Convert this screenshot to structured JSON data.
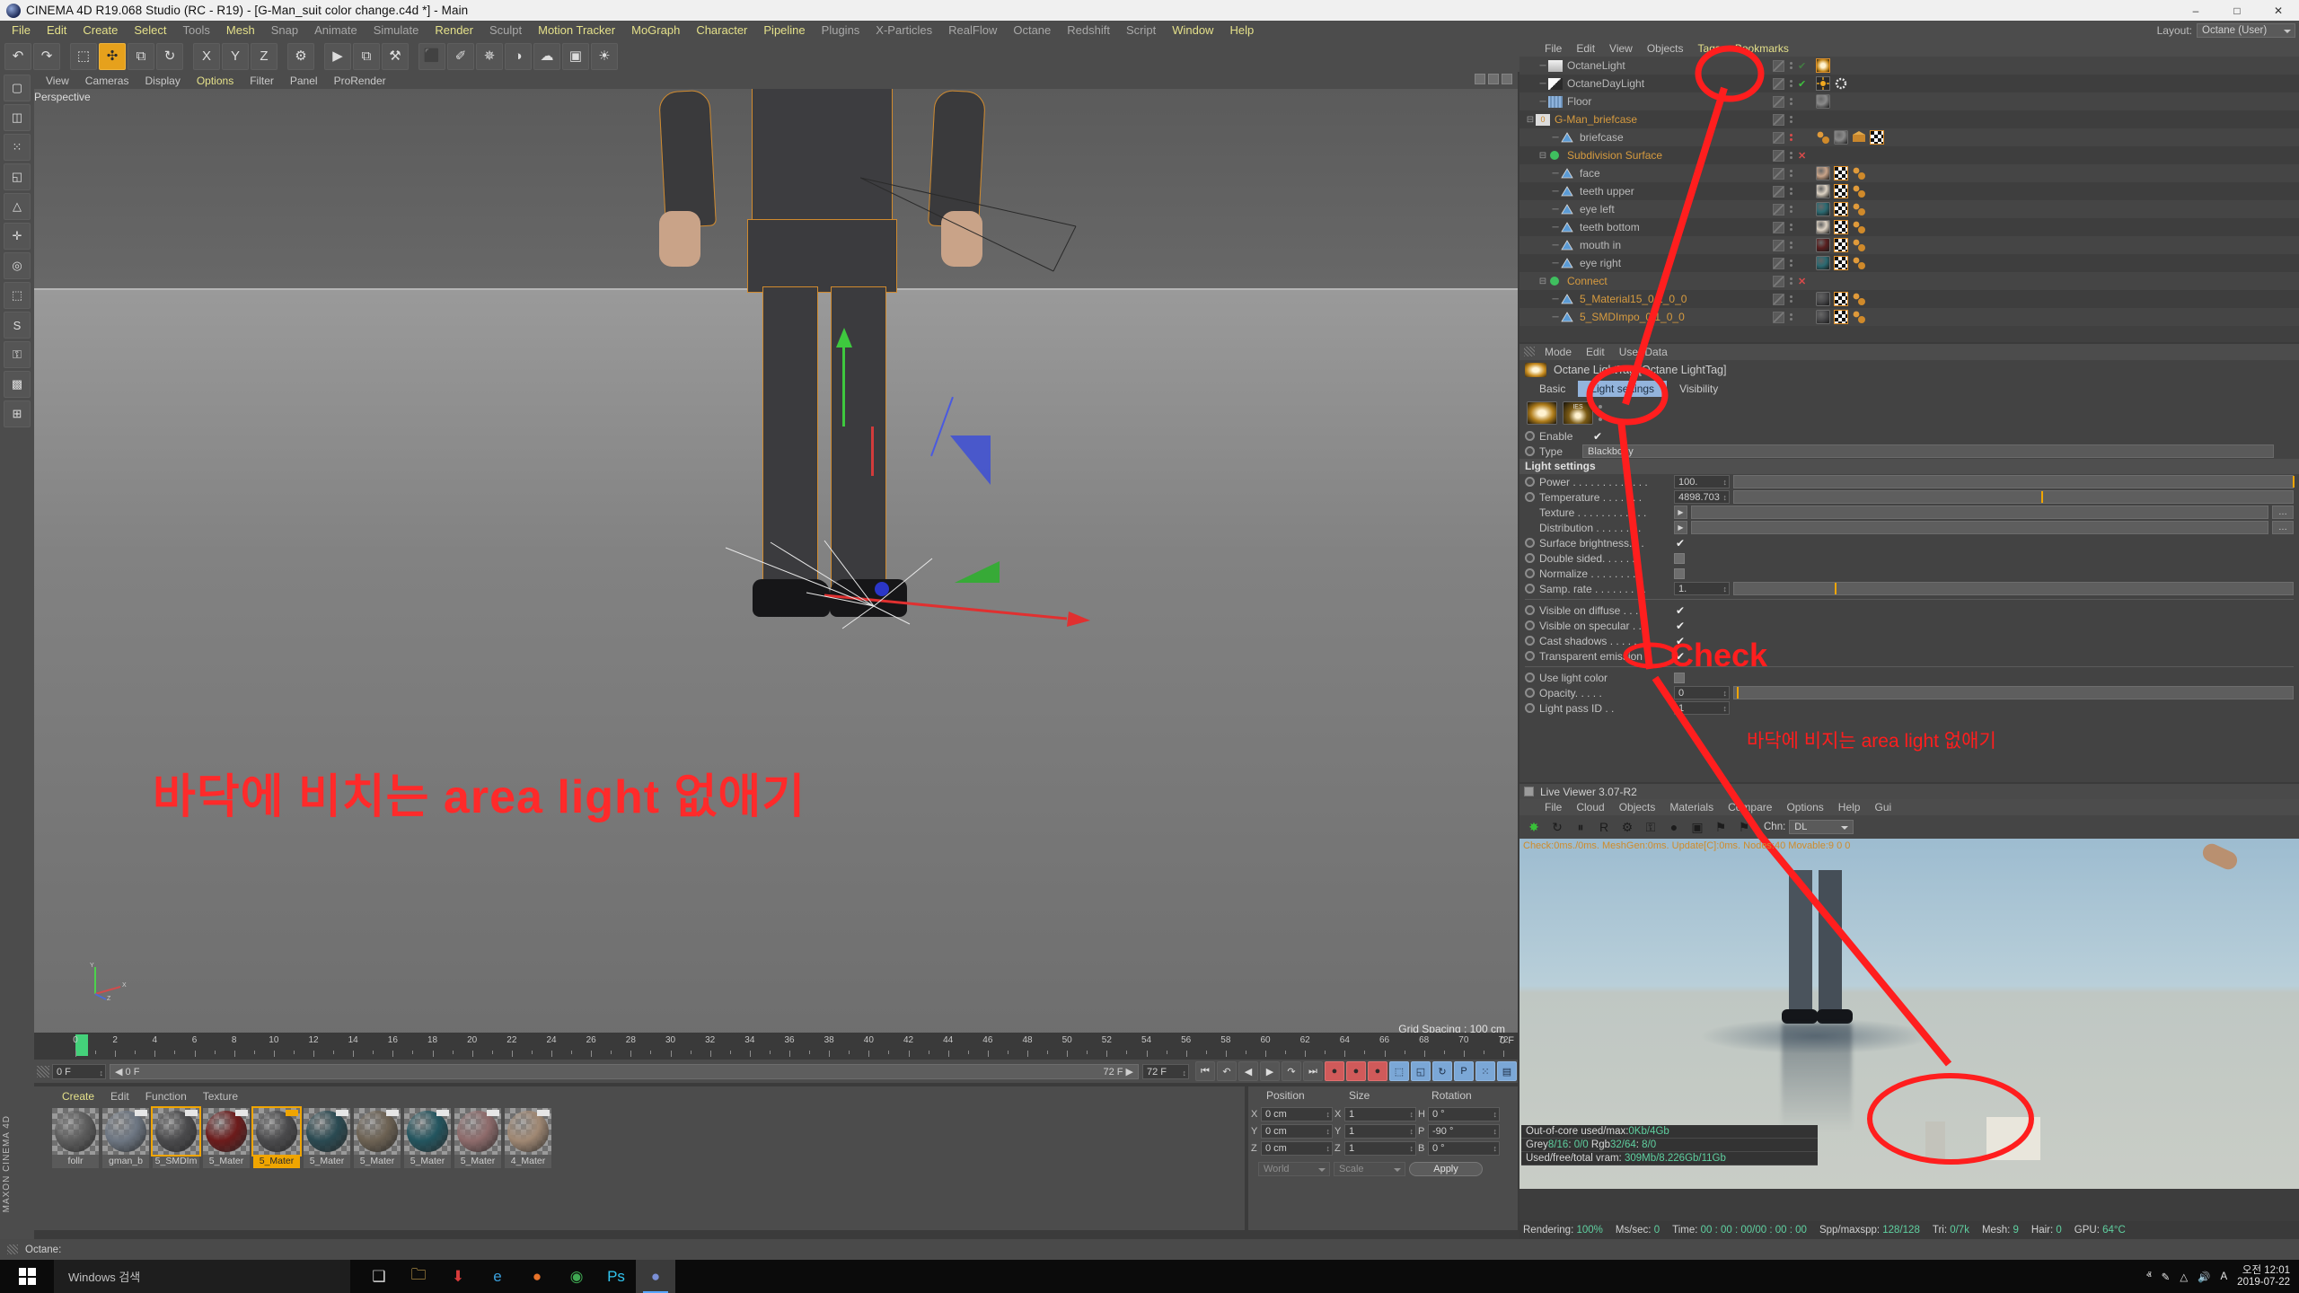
{
  "window": {
    "title": "CINEMA 4D R19.068 Studio (RC - R19) - [G-Man_suit color change.c4d *] - Main",
    "minimize": "–",
    "maximize": "□",
    "close": "✕"
  },
  "menubar": {
    "items": [
      {
        "label": "File",
        "hi": true
      },
      {
        "label": "Edit",
        "hi": true
      },
      {
        "label": "Create",
        "hi": true
      },
      {
        "label": "Select",
        "hi": true
      },
      {
        "label": "Tools",
        "hi": false
      },
      {
        "label": "Mesh",
        "hi": true
      },
      {
        "label": "Snap",
        "hi": false
      },
      {
        "label": "Animate",
        "hi": false
      },
      {
        "label": "Simulate",
        "hi": false
      },
      {
        "label": "Render",
        "hi": true
      },
      {
        "label": "Sculpt",
        "hi": false
      },
      {
        "label": "Motion Tracker",
        "hi": true
      },
      {
        "label": "MoGraph",
        "hi": true
      },
      {
        "label": "Character",
        "hi": true
      },
      {
        "label": "Pipeline",
        "hi": true
      },
      {
        "label": "Plugins",
        "hi": false
      },
      {
        "label": "X-Particles",
        "hi": false
      },
      {
        "label": "RealFlow",
        "hi": false
      },
      {
        "label": "Octane",
        "hi": false
      },
      {
        "label": "Redshift",
        "hi": false
      },
      {
        "label": "Script",
        "hi": false
      },
      {
        "label": "Window",
        "hi": true
      },
      {
        "label": "Help",
        "hi": true
      }
    ],
    "layout_label": "Layout:",
    "layout_value": "Octane (User)"
  },
  "toolbar": {
    "buttons": [
      {
        "name": "undo",
        "glyph": "↶",
        "sel": false
      },
      {
        "name": "redo",
        "glyph": "↷",
        "sel": false
      },
      {
        "name": "live-selection",
        "glyph": "⬚",
        "sel": false
      },
      {
        "name": "move",
        "glyph": "✣",
        "sel": true
      },
      {
        "name": "scale",
        "glyph": "⧉",
        "sel": false
      },
      {
        "name": "rotate",
        "glyph": "↻",
        "sel": false
      },
      {
        "name": "lock-x",
        "glyph": "X",
        "sel": false
      },
      {
        "name": "lock-y",
        "glyph": "Y",
        "sel": false
      },
      {
        "name": "lock-z",
        "glyph": "Z",
        "sel": false
      },
      {
        "name": "world-object",
        "glyph": "⚙",
        "sel": false
      },
      {
        "name": "render-view",
        "glyph": "▶",
        "sel": false
      },
      {
        "name": "render-region",
        "glyph": "⧉",
        "sel": false
      },
      {
        "name": "render-settings",
        "glyph": "⚒",
        "sel": false
      },
      {
        "name": "cube-primitive",
        "glyph": "⬛",
        "sel": false
      },
      {
        "name": "spline-pen",
        "glyph": "✐",
        "sel": false
      },
      {
        "name": "generator",
        "glyph": "✵",
        "sel": false
      },
      {
        "name": "bend-deformer",
        "glyph": "◑",
        "sel": false
      },
      {
        "name": "environment",
        "glyph": "☁",
        "sel": false
      },
      {
        "name": "camera",
        "glyph": "▣",
        "sel": false
      },
      {
        "name": "light",
        "glyph": "☀",
        "sel": false
      }
    ],
    "right_buttons": [
      {
        "name": "octane-live-viewer",
        "glyph": "✸"
      },
      {
        "name": "octane-settings",
        "glyph": "▦"
      },
      {
        "name": "octane-texture",
        "glyph": "T"
      },
      {
        "name": "octane-object",
        "glyph": "□"
      },
      {
        "name": "nav-prev",
        "glyph": "‹"
      },
      {
        "name": "nav-next",
        "glyph": "›"
      },
      {
        "name": "layout-panels",
        "glyph": "▤"
      }
    ]
  },
  "left_toolbar": {
    "buttons": [
      {
        "name": "model-mode",
        "glyph": "▢"
      },
      {
        "name": "texture-mode",
        "glyph": "◫"
      },
      {
        "name": "points-mode",
        "glyph": "⁙"
      },
      {
        "name": "edges-mode",
        "glyph": "◱"
      },
      {
        "name": "polygons-mode",
        "glyph": "△"
      },
      {
        "name": "enable-axis",
        "glyph": "✛"
      },
      {
        "name": "viewport-solo",
        "glyph": "◎"
      },
      {
        "name": "workplane",
        "glyph": "⬚"
      },
      {
        "name": "snap-toggle",
        "glyph": "S"
      },
      {
        "name": "lock-transform",
        "glyph": "⚿"
      },
      {
        "name": "texture-axis",
        "glyph": "▩"
      },
      {
        "name": "uv-mode",
        "glyph": "⊞"
      }
    ],
    "brand": "MAXON CINEMA 4D"
  },
  "viewport": {
    "menu": [
      {
        "label": "View",
        "hi": false
      },
      {
        "label": "Cameras",
        "hi": false
      },
      {
        "label": "Display",
        "hi": false
      },
      {
        "label": "Options",
        "hi": true
      },
      {
        "label": "Filter",
        "hi": false
      },
      {
        "label": "Panel",
        "hi": false
      },
      {
        "label": "ProRender",
        "hi": false
      }
    ],
    "label": "Perspective",
    "grid_spacing": "Grid Spacing : 100 cm",
    "axis": {
      "x": "X",
      "y": "Y",
      "z": "Z"
    }
  },
  "annotations": {
    "korean_main": "바닥에 비치는 area light 없애기",
    "check_label": "Check",
    "korean_small": "바닥에 비지는 area light 없애기",
    "color": "#ff2a2a"
  },
  "timeline": {
    "ticks": [
      0,
      2,
      4,
      6,
      8,
      10,
      12,
      14,
      16,
      18,
      20,
      22,
      24,
      26,
      28,
      30,
      32,
      34,
      36,
      38,
      40,
      42,
      44,
      46,
      48,
      50,
      52,
      54,
      56,
      58,
      60,
      62,
      64,
      66,
      68,
      70,
      72
    ],
    "current_frame": "0 F",
    "end_frame_right": "0 F",
    "range_start": "0 F",
    "range_preview_start": "0 F",
    "range_preview_end": "72 F",
    "range_end": "72 F",
    "transport": [
      {
        "name": "goto-start",
        "glyph": "⏮"
      },
      {
        "name": "step-back",
        "glyph": "↶"
      },
      {
        "name": "play-back",
        "glyph": "◀"
      },
      {
        "name": "play-forward",
        "glyph": "▶"
      },
      {
        "name": "step-forward",
        "glyph": "↷"
      },
      {
        "name": "goto-end",
        "glyph": "⏭"
      }
    ],
    "record": [
      {
        "name": "record-keyframe",
        "glyph": "●"
      },
      {
        "name": "autokey",
        "glyph": "●"
      },
      {
        "name": "keyframe-selection",
        "glyph": "●"
      }
    ],
    "keytools": [
      {
        "name": "position-key",
        "glyph": "⬚"
      },
      {
        "name": "scale-key",
        "glyph": "◱"
      },
      {
        "name": "rotation-key",
        "glyph": "↻"
      },
      {
        "name": "param-key",
        "glyph": "P"
      },
      {
        "name": "pla-key",
        "glyph": "⁙"
      },
      {
        "name": "timeline-view",
        "glyph": "▤"
      }
    ]
  },
  "materials": {
    "menu": [
      {
        "label": "Create",
        "hi": true
      },
      {
        "label": "Edit",
        "hi": false
      },
      {
        "label": "Function",
        "hi": false
      },
      {
        "label": "Texture",
        "hi": false
      }
    ],
    "items": [
      {
        "name": "follr",
        "color": "#5d5d5d",
        "sel": false,
        "flag": false
      },
      {
        "name": "gman_b",
        "color": "#6d7682",
        "sel": false,
        "flag": true
      },
      {
        "name": "5_SMDIm",
        "color": "#4a4a4c",
        "sel": false,
        "flag": true,
        "outline": true
      },
      {
        "name": "5_Mater",
        "color": "#6d1b1b",
        "sel": false,
        "flag": true
      },
      {
        "name": "5_Mater",
        "color": "#4a4a4c",
        "sel": true,
        "flag": true
      },
      {
        "name": "5_Mater",
        "color": "#2a4a52",
        "sel": false,
        "flag": true
      },
      {
        "name": "5_Mater",
        "color": "#6d6253",
        "sel": false,
        "flag": true
      },
      {
        "name": "5_Mater",
        "color": "#23555f",
        "sel": false,
        "flag": true
      },
      {
        "name": "5_Mater",
        "color": "#8e6b6b",
        "sel": false,
        "flag": true
      },
      {
        "name": "4_Mater",
        "color": "#a08873",
        "sel": false,
        "flag": true
      }
    ]
  },
  "coordinates": {
    "headers": [
      "Position",
      "Size",
      "Rotation"
    ],
    "rows": [
      {
        "axis1": "X",
        "v1": "0 cm",
        "axis2": "X",
        "v2": "1",
        "axis3": "H",
        "v3": "0 °"
      },
      {
        "axis1": "Y",
        "v1": "0 cm",
        "axis2": "Y",
        "v2": "1",
        "axis3": "P",
        "v3": "-90 °"
      },
      {
        "axis1": "Z",
        "v1": "0 cm",
        "axis2": "Z",
        "v2": "1",
        "axis3": "B",
        "v3": "0 °"
      }
    ],
    "system": "World",
    "mode": "Scale",
    "apply": "Apply"
  },
  "object_manager": {
    "menu": [
      {
        "label": "File",
        "hi": false
      },
      {
        "label": "Edit",
        "hi": false
      },
      {
        "label": "View",
        "hi": false
      },
      {
        "label": "Objects",
        "hi": false
      },
      {
        "label": "Tags",
        "hi": true
      },
      {
        "label": "Bookmarks",
        "hi": true
      }
    ],
    "rows": [
      {
        "name": "OctaneLight",
        "indent": 1,
        "color": "grey",
        "icon": "light-icon",
        "tags": [
          "lamp"
        ],
        "dots": true,
        "check": "green-faint"
      },
      {
        "name": "OctaneDayLight",
        "indent": 1,
        "color": "grey",
        "icon": "daylight-icon",
        "tags": [
          "sun",
          "gear"
        ],
        "dots": true,
        "check": "green"
      },
      {
        "name": "Floor",
        "indent": 1,
        "color": "grey",
        "icon": "floor-icon",
        "tags": [
          "sphere"
        ],
        "dots": true
      },
      {
        "name": "G-Man_briefcase",
        "indent": 0,
        "color": "orange",
        "icon": "layer-icon",
        "tags": [],
        "dots": false
      },
      {
        "name": "briefcase",
        "indent": 2,
        "color": "grey",
        "icon": "poly-icon",
        "tags": [
          "mat",
          "sphere",
          "uv",
          "checker"
        ],
        "dots": "red"
      },
      {
        "name": "Subdivision Surface",
        "indent": 1,
        "color": "orange",
        "icon": "subdiv-icon",
        "tags": [],
        "x": true
      },
      {
        "name": "face",
        "indent": 2,
        "color": "grey",
        "icon": "poly-icon",
        "tags": [
          "face",
          "checker",
          "mat"
        ],
        "dots": true
      },
      {
        "name": "teeth upper",
        "indent": 2,
        "color": "grey",
        "icon": "poly-icon",
        "tags": [
          "teeth",
          "checker",
          "mat"
        ],
        "dots": true
      },
      {
        "name": "eye left",
        "indent": 2,
        "color": "grey",
        "icon": "poly-icon",
        "tags": [
          "eye",
          "checker",
          "mat"
        ],
        "dots": true
      },
      {
        "name": "teeth bottom",
        "indent": 2,
        "color": "grey",
        "icon": "poly-icon",
        "tags": [
          "teeth",
          "checker",
          "mat"
        ],
        "dots": true
      },
      {
        "name": "mouth in",
        "indent": 2,
        "color": "grey",
        "icon": "poly-icon",
        "tags": [
          "mouth",
          "checker",
          "mat"
        ],
        "dots": true
      },
      {
        "name": "eye right",
        "indent": 2,
        "color": "grey",
        "icon": "poly-icon",
        "tags": [
          "eye",
          "checker",
          "mat"
        ],
        "dots": true
      },
      {
        "name": "Connect",
        "indent": 1,
        "color": "orange",
        "icon": "connect-icon",
        "tags": [],
        "x": true
      },
      {
        "name": "5_Material15_0.1_0_0",
        "indent": 2,
        "color": "orange",
        "icon": "poly-icon",
        "tags": [
          "suit",
          "checker",
          "mat"
        ],
        "dots": true
      },
      {
        "name": "5_SMDImpo_0.1_0_0",
        "indent": 2,
        "color": "orange",
        "icon": "poly-icon",
        "tags": [
          "suit",
          "checker",
          "mat"
        ],
        "dots": true
      }
    ]
  },
  "attribute_manager": {
    "menu": [
      {
        "label": "Mode"
      },
      {
        "label": "Edit"
      },
      {
        "label": "User Data"
      }
    ],
    "header": "Octane LightTag [Octane LightTag]",
    "tabs": [
      {
        "label": "Basic",
        "active": false
      },
      {
        "label": "Light settings",
        "active": true
      },
      {
        "label": "Visibility",
        "active": false
      }
    ],
    "enable_label": "Enable",
    "enable_value": true,
    "type_label": "Type",
    "type_value": "Blackbody",
    "section_title": "Light settings",
    "fields": [
      {
        "label": "Power . . . . . . . . . . . . .",
        "value": "100.",
        "kind": "slider",
        "fill": 1.0,
        "bullet": true
      },
      {
        "label": "Temperature . . . . . . .",
        "value": "4898.703",
        "kind": "slider",
        "fill": 0.55,
        "bullet": true
      },
      {
        "label": "Texture . . . . . . . . . . . .",
        "value": "",
        "kind": "texture",
        "bullet": false
      },
      {
        "label": "Distribution . . . . . . . .",
        "value": "",
        "kind": "texture",
        "bullet": false
      },
      {
        "label": "Surface brightness. . .",
        "value": "",
        "kind": "check",
        "checked": true,
        "bullet": true
      },
      {
        "label": "Double sided. . . . . . .",
        "value": "",
        "kind": "box",
        "checked": false,
        "bullet": true
      },
      {
        "label": "Normalize . . . . . . . . .",
        "value": "",
        "kind": "box",
        "checked": false,
        "bullet": true
      },
      {
        "label": "Samp. rate . . . . . . . . .",
        "value": "1.",
        "kind": "slider",
        "fill": 0.18,
        "bullet": true
      }
    ],
    "visibility_fields": [
      {
        "label": "Visible on diffuse  . . .",
        "checked": true
      },
      {
        "label": "Visible on specular . .",
        "checked": true
      },
      {
        "label": "Cast shadows  . . . . . .",
        "checked": true
      },
      {
        "label": "Transparent emission",
        "checked": true
      }
    ],
    "bottom_fields": [
      {
        "label": "Use light color",
        "kind": "box",
        "checked": false
      },
      {
        "label": "Opacity. . . . .",
        "kind": "slider",
        "value": "0",
        "fill": 0.005
      },
      {
        "label": "Light pass ID . .",
        "kind": "num",
        "value": "1"
      }
    ]
  },
  "live_viewer": {
    "title": "Live Viewer 3.07-R2",
    "menu": [
      {
        "label": "File"
      },
      {
        "label": "Cloud"
      },
      {
        "label": "Objects"
      },
      {
        "label": "Materials"
      },
      {
        "label": "Compare"
      },
      {
        "label": "Options"
      },
      {
        "label": "Help"
      },
      {
        "label": "Gui"
      }
    ],
    "tools": [
      {
        "name": "octane-render-start",
        "glyph": "✸",
        "color": "#39c039"
      },
      {
        "name": "refresh",
        "glyph": "↻",
        "color": "#1c1c1c"
      },
      {
        "name": "pause",
        "glyph": "⏸",
        "color": "#1c1c1c"
      },
      {
        "name": "region-render",
        "glyph": "R",
        "color": "#1c1c1c"
      },
      {
        "name": "settings-gear",
        "glyph": "⚙",
        "color": "#1c1c1c"
      },
      {
        "name": "lock",
        "glyph": "⚿",
        "color": "#1c1c1c"
      },
      {
        "name": "material-preview",
        "glyph": "●",
        "color": "#1c1c1c"
      },
      {
        "name": "picture-viewer",
        "glyph": "▣",
        "color": "#1c1c1c"
      },
      {
        "name": "pin-h",
        "glyph": "⚑",
        "color": "#1c1c1c"
      },
      {
        "name": "pin-m",
        "glyph": "⚑",
        "color": "#1c1c1c"
      }
    ],
    "channel_label": "Chn:",
    "channel_value": "DL",
    "stats_line": "Check:0ms./0ms. MeshGen:0ms. Update[C]:0ms. Nodes:40 Movable:9  0 0",
    "info_rows": [
      {
        "text": "Out-of-core used/max:",
        "value": "0Kb/4Gb"
      },
      {
        "text": "Grey8/16: 0/0        Rgb32/64: 8/0",
        "value": ""
      },
      {
        "text": "Used/free/total vram: ",
        "value": "309Mb/8.226Gb/11Gb"
      }
    ],
    "status": [
      {
        "label": "Rendering:",
        "value": "100%"
      },
      {
        "label": "Ms/sec:",
        "value": "0"
      },
      {
        "label": "Time:",
        "value": "00 : 00 : 00/00 : 00 : 00"
      },
      {
        "label": "Spp/maxspp:",
        "value": "128/128"
      },
      {
        "label": "Tri:",
        "value": "0/7k"
      },
      {
        "label": "Mesh:",
        "value": "9"
      },
      {
        "label": "Hair:",
        "value": "0"
      },
      {
        "label": "GPU:",
        "value": "64°C"
      }
    ]
  },
  "statusbar": {
    "text": "Octane:"
  },
  "taskbar": {
    "search_placeholder": "Windows 검색",
    "items": [
      {
        "name": "task-view",
        "glyph": "❑",
        "color": "#d8d8d8",
        "active": false
      },
      {
        "name": "file-explorer",
        "glyph": "🗀",
        "color": "#f5c45e",
        "active": false
      },
      {
        "name": "download-manager",
        "glyph": "⬇",
        "color": "#d93b3b",
        "active": false
      },
      {
        "name": "internet-explorer",
        "glyph": "e",
        "color": "#3aa0dd",
        "active": false
      },
      {
        "name": "firefox",
        "glyph": "●",
        "color": "#e8732a",
        "active": false
      },
      {
        "name": "chrome",
        "glyph": "◉",
        "color": "#3fa852",
        "active": false
      },
      {
        "name": "photoshop",
        "glyph": "Ps",
        "color": "#31c5f0",
        "active": false
      },
      {
        "name": "cinema-4d",
        "glyph": "●",
        "color": "#7a8fd6",
        "active": true
      }
    ],
    "tray": [
      {
        "name": "chevron-up-icon",
        "glyph": "ⱏ"
      },
      {
        "name": "pen-icon",
        "glyph": "✎"
      },
      {
        "name": "network-icon",
        "glyph": "△"
      },
      {
        "name": "volume-icon",
        "glyph": "🔊"
      },
      {
        "name": "ime-icon",
        "glyph": "A"
      }
    ],
    "clock_time": "오전 12:01",
    "clock_date": "2019-07-22"
  }
}
